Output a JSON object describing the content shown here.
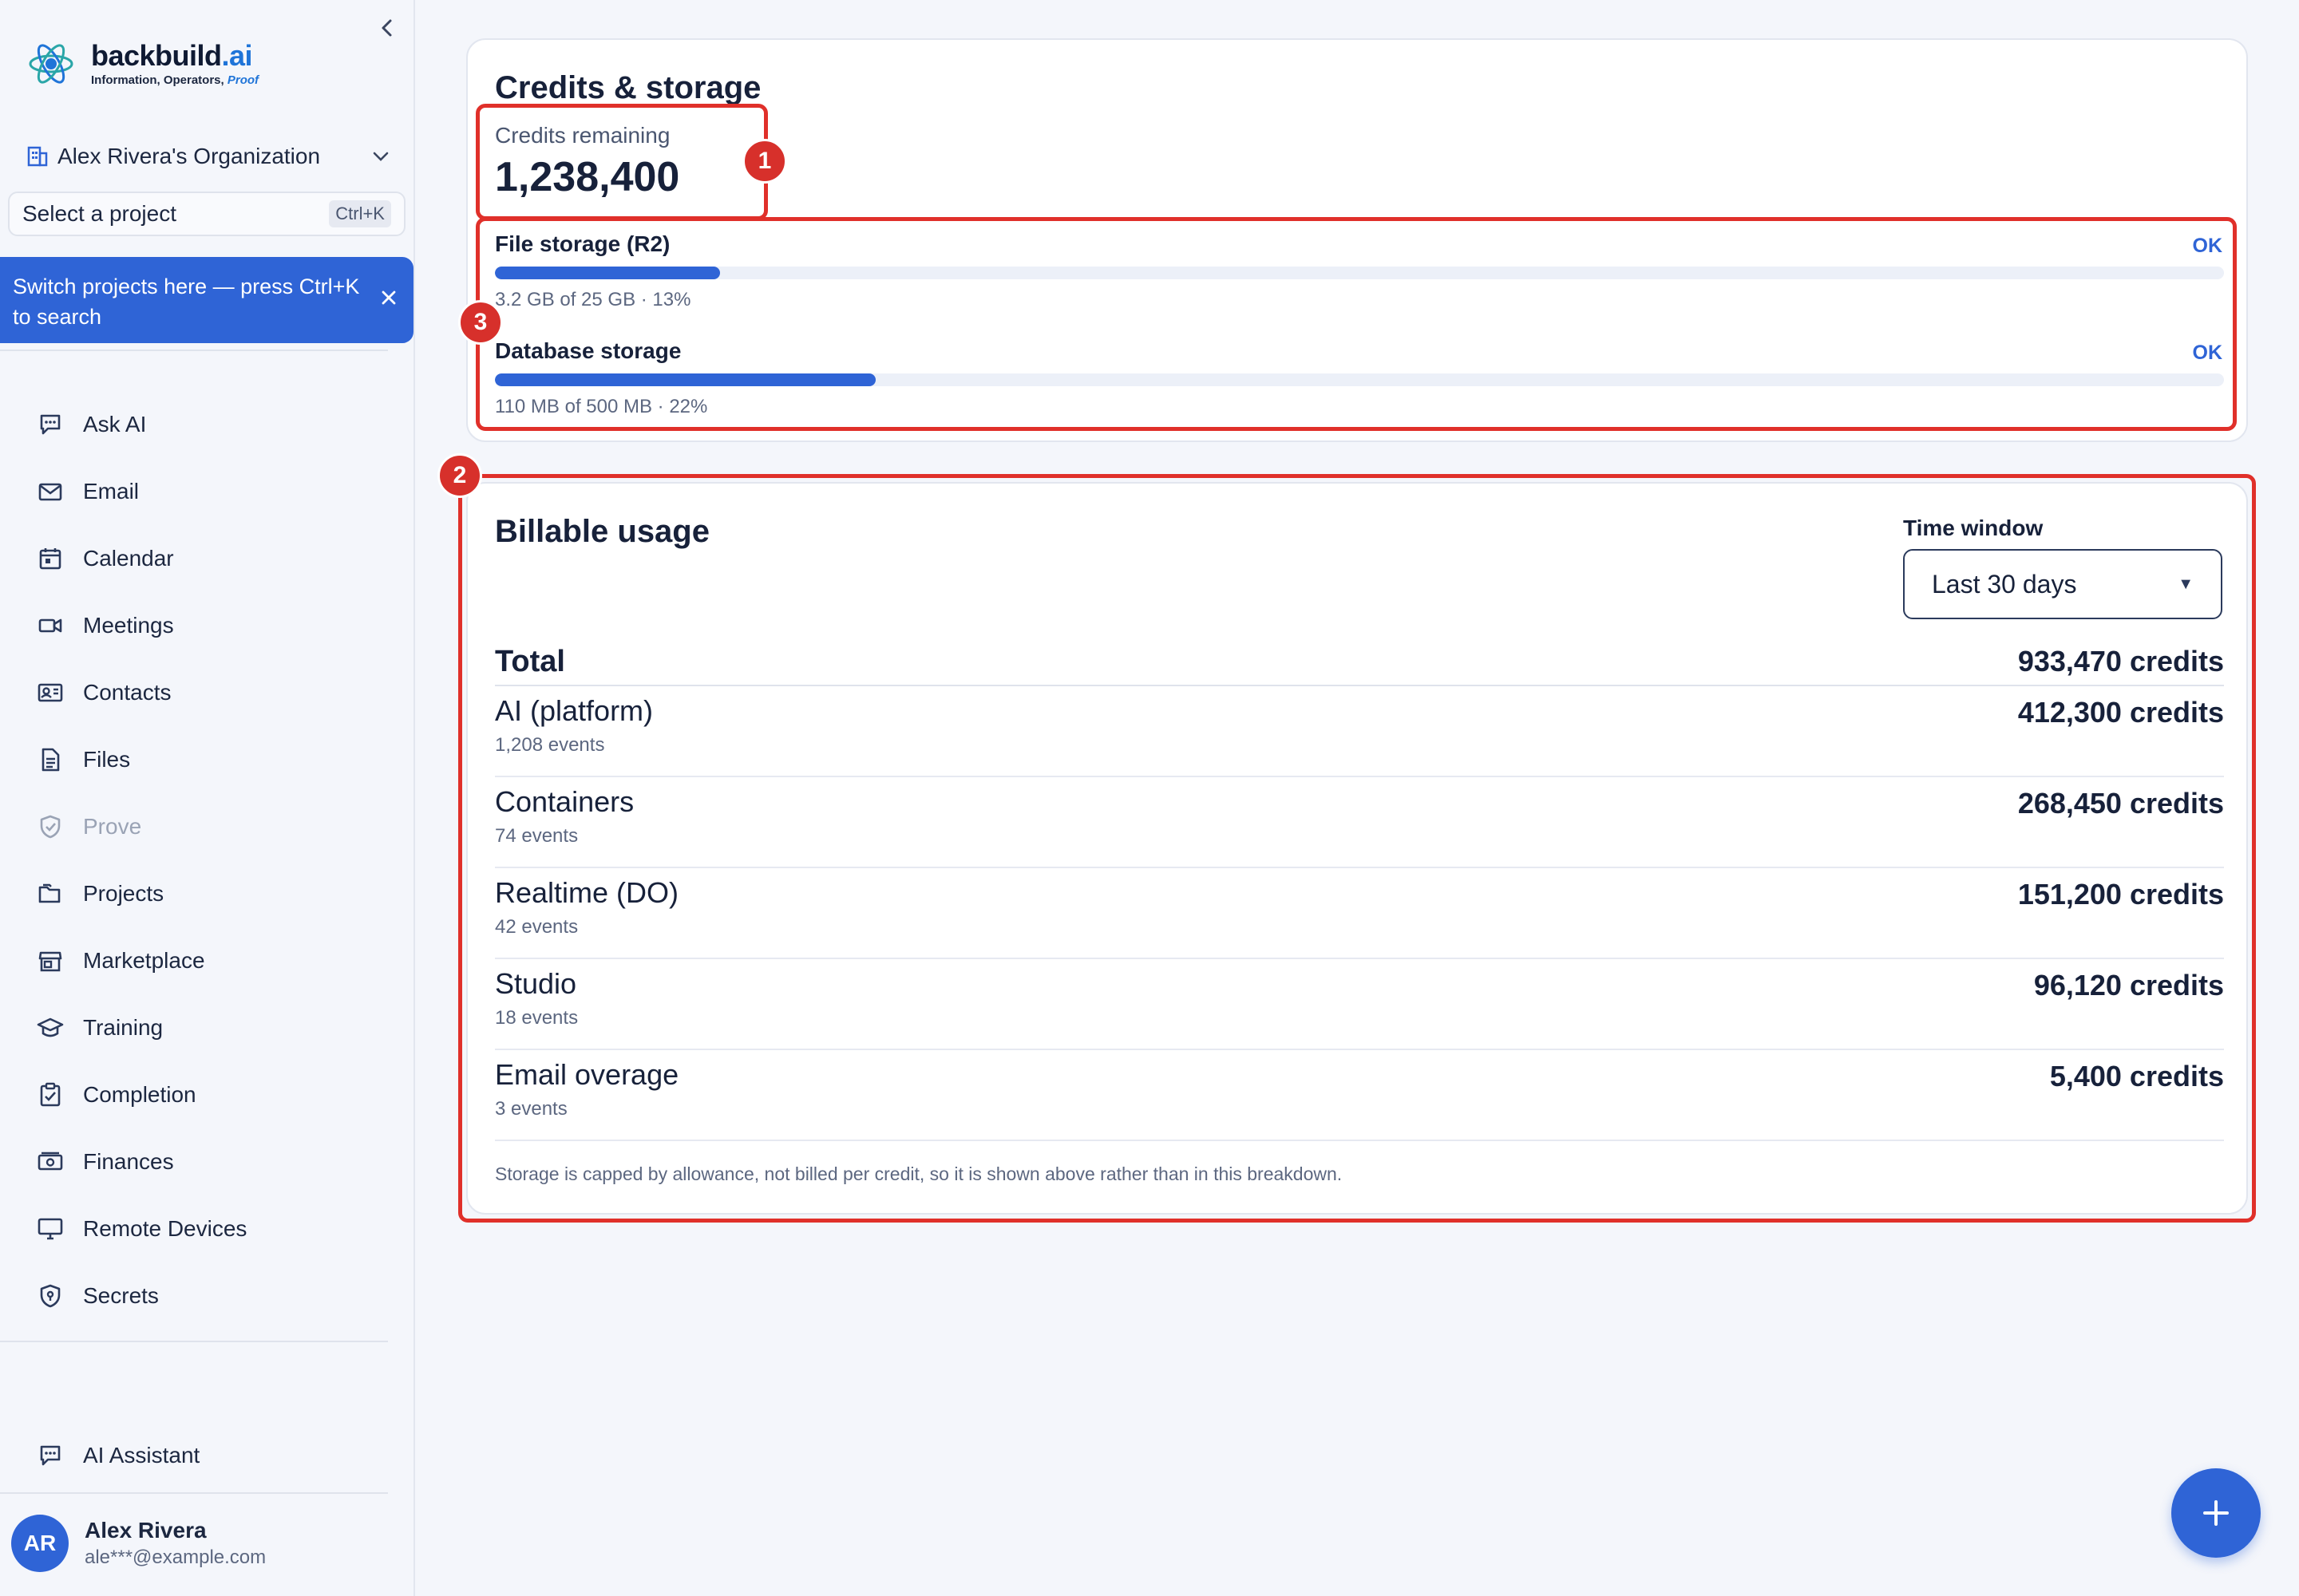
{
  "brand": {
    "name_main": "backbuild",
    "name_suffix": ".ai",
    "tagline_main": "Information, Operators, ",
    "tagline_accent": "Proof"
  },
  "sidebar": {
    "org_name": "Alex Rivera's Organization",
    "project_placeholder": "Select a project",
    "project_shortcut": "Ctrl+K",
    "tip": "Switch projects here — press Ctrl+K to search",
    "nav": [
      {
        "label": "Ask AI",
        "icon": "chat-icon"
      },
      {
        "label": "Email",
        "icon": "mail-icon"
      },
      {
        "label": "Calendar",
        "icon": "calendar-icon"
      },
      {
        "label": "Meetings",
        "icon": "video-icon"
      },
      {
        "label": "Contacts",
        "icon": "contact-card-icon"
      },
      {
        "label": "Files",
        "icon": "file-icon"
      },
      {
        "label": "Prove",
        "icon": "shield-check-icon",
        "disabled": true
      },
      {
        "label": "Projects",
        "icon": "folders-icon"
      },
      {
        "label": "Marketplace",
        "icon": "store-icon"
      },
      {
        "label": "Training",
        "icon": "graduation-cap-icon"
      },
      {
        "label": "Completion",
        "icon": "clipboard-check-icon"
      },
      {
        "label": "Finances",
        "icon": "money-icon"
      },
      {
        "label": "Remote Devices",
        "icon": "monitor-icon"
      },
      {
        "label": "Secrets",
        "icon": "shield-lock-icon"
      }
    ],
    "assistant_label": "AI Assistant",
    "user": {
      "initials": "AR",
      "name": "Alex Rivera",
      "email": "ale***@example.com"
    }
  },
  "credits_card": {
    "title": "Credits & storage",
    "credits_label": "Credits remaining",
    "credits_value": "1,238,400",
    "storage": [
      {
        "label": "File storage (R2)",
        "status": "OK",
        "fraction": 0.13,
        "detail": "3.2 GB of 25 GB · 13%"
      },
      {
        "label": "Database storage",
        "status": "OK",
        "fraction": 0.22,
        "detail": "110 MB of 500 MB · 22%"
      }
    ]
  },
  "usage_card": {
    "title": "Billable usage",
    "time_window_label": "Time window",
    "time_window_value": "Last 30 days",
    "total_label": "Total",
    "total_value": "933,470 credits",
    "rows": [
      {
        "name": "AI (platform)",
        "events": "1,208 events",
        "value": "412,300 credits"
      },
      {
        "name": "Containers",
        "events": "74 events",
        "value": "268,450 credits"
      },
      {
        "name": "Realtime (DO)",
        "events": "42 events",
        "value": "151,200 credits"
      },
      {
        "name": "Studio",
        "events": "18 events",
        "value": "96,120 credits"
      },
      {
        "name": "Email overage",
        "events": "3 events",
        "value": "5,400 credits"
      }
    ],
    "note": "Storage is capped by allowance, not billed per credit, so it is shown above rather than in this breakdown."
  },
  "annotations": [
    "1",
    "2",
    "3"
  ],
  "colors": {
    "accent": "#2f64d6",
    "annotation": "#e0302a",
    "text": "#17213a"
  }
}
